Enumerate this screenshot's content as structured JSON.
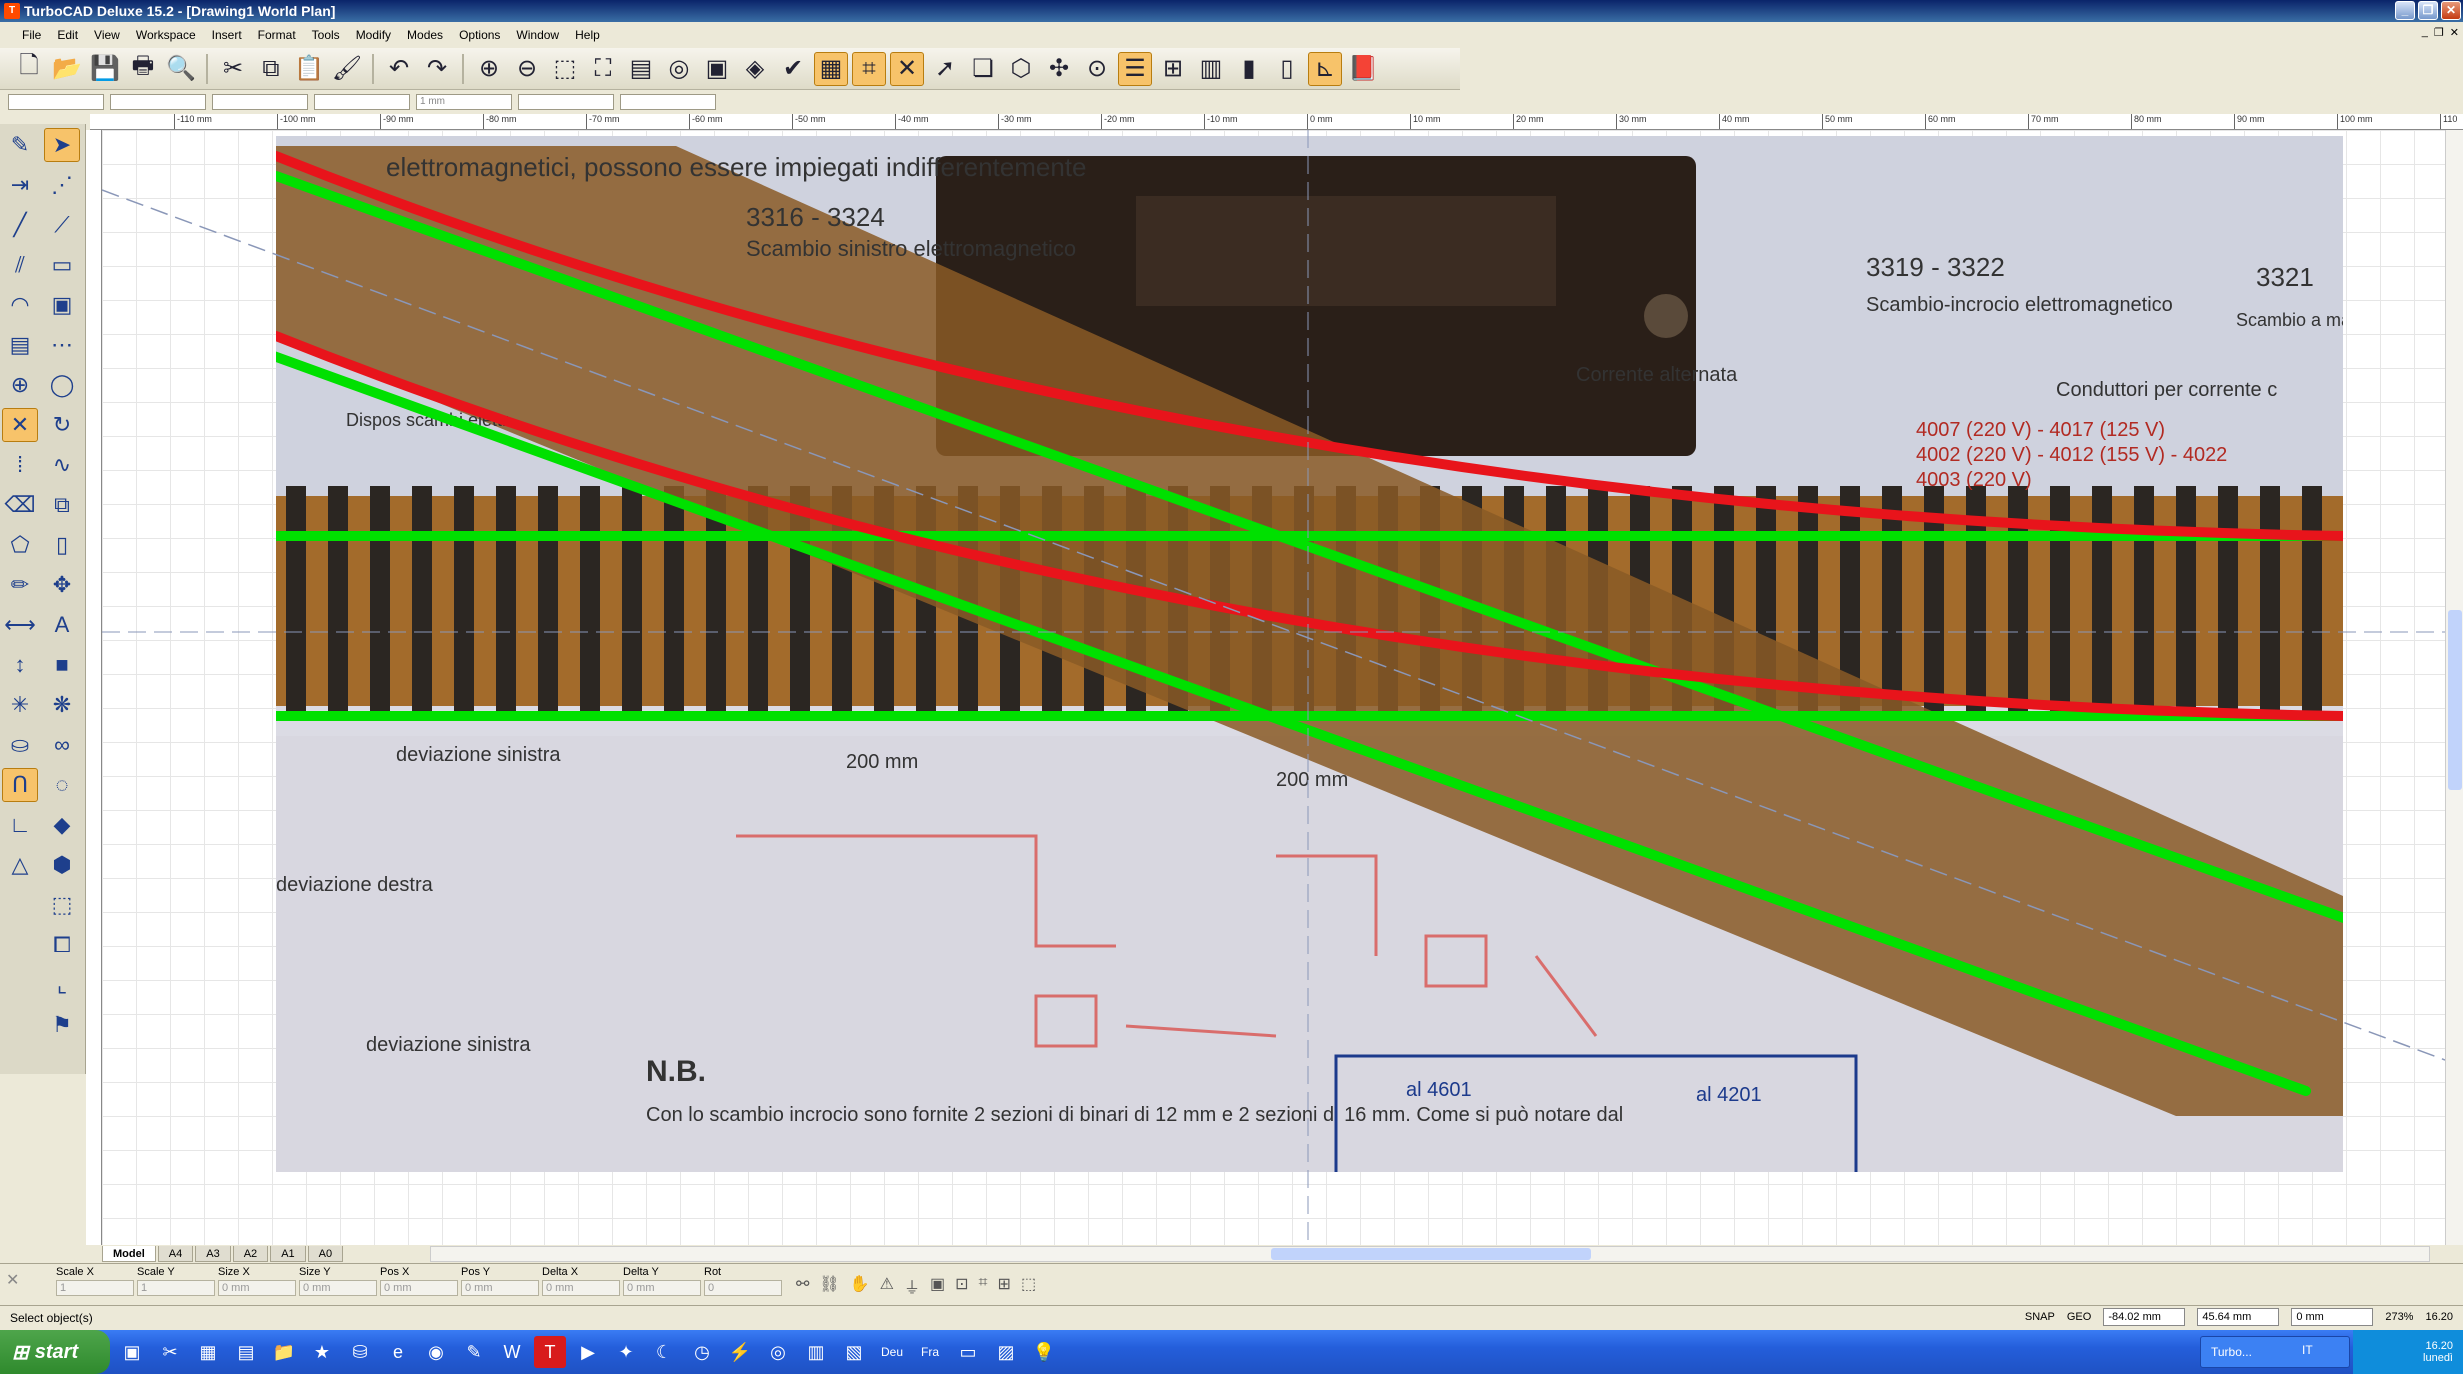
{
  "window": {
    "title": "TurboCAD Deluxe 15.2 - [Drawing1 World Plan]",
    "app_icon": "turbocad-icon"
  },
  "menu": [
    "File",
    "Edit",
    "View",
    "Workspace",
    "Insert",
    "Format",
    "Tools",
    "Modify",
    "Modes",
    "Options",
    "Window",
    "Help"
  ],
  "toolbar": {
    "icons": [
      "new-icon",
      "open-icon",
      "save-icon",
      "print-icon",
      "print-preview-icon",
      "cut-icon",
      "copy-icon",
      "paste-icon",
      "format-painter-icon",
      "undo-icon",
      "redo-icon",
      "zoom-in-icon",
      "zoom-out-icon",
      "zoom-window-icon",
      "zoom-extents-icon",
      "pages-icon",
      "zoom-all-icon",
      "render-icon",
      "snap-icon",
      "spell-check-icon",
      "grid-icon",
      "snap-grid-icon",
      "snap-intersect-icon",
      "select-icon",
      "layers-icon",
      "3d-box-icon",
      "3d-orbit-icon",
      "camera-icon",
      "design-director-icon",
      "properties-icon",
      "hatch-icon",
      "palette-icon",
      "page-icon",
      "ucs-icon",
      "book-icon"
    ]
  },
  "property_bar": {
    "line_width": "1 mm"
  },
  "ruler": {
    "ticks": [
      "-110 mm",
      "-100 mm",
      "-90 mm",
      "-80 mm",
      "-70 mm",
      "-60 mm",
      "-50 mm",
      "-40 mm",
      "-30 mm",
      "-20 mm",
      "-10 mm",
      "0 mm",
      "10 mm",
      "20 mm",
      "30 mm",
      "40 mm",
      "50 mm",
      "60 mm",
      "70 mm",
      "80 mm",
      "90 mm",
      "100 mm",
      "110"
    ]
  },
  "drawing": {
    "photo_labels": {
      "part_a": "3316 - 3324",
      "part_a_desc": "Scambio sinistro elettromagnetico",
      "part_b": "3319 - 3322",
      "part_b_desc": "Scambio-incrocio elettromagnetico",
      "part_c": "3321",
      "part_c_desc": "Scambio a mano",
      "top_text": "elettromagnetici, possono essere impiegati indifferentemente",
      "corrente": "Corrente alternata",
      "conduttori": "Conduttori per corrente c",
      "codes": [
        "4007 (220 V) - 4017 (125 V)",
        "4002 (220 V) - 4012 (155 V) - 4022",
        "4003 (220 V)"
      ],
      "dev_sx1": "deviazione sinistra",
      "dev_dx": "deviazione destra",
      "dev_sx2": "deviazione sinistra",
      "dim1": "200 mm",
      "dim2": "200 mm",
      "nb_title": "N.B.",
      "nb_text": "Con lo scambio incrocio sono fornite 2 sezioni di binari di 12 mm e 2 sezioni di 16 mm. Come si può notare dal",
      "box_a": "al 4601",
      "box_b": "al 4201",
      "dispos": "Dispos scambi elettr"
    },
    "colors": {
      "track_green": "#00e000",
      "track_red": "#e8141b"
    }
  },
  "tabs": [
    "Model",
    "A4",
    "A3",
    "A2",
    "A1",
    "A0"
  ],
  "inspector": {
    "fields": [
      {
        "label": "Scale X",
        "value": "1"
      },
      {
        "label": "Scale Y",
        "value": "1"
      },
      {
        "label": "Size X",
        "value": "0 mm"
      },
      {
        "label": "Size Y",
        "value": "0 mm"
      },
      {
        "label": "Pos X",
        "value": "0 mm"
      },
      {
        "label": "Pos Y",
        "value": "0 mm"
      },
      {
        "label": "Delta X",
        "value": "0 mm"
      },
      {
        "label": "Delta Y",
        "value": "0 mm"
      },
      {
        "label": "Rot",
        "value": "0"
      }
    ]
  },
  "status": {
    "message": "Select object(s)",
    "snap": "SNAP",
    "geo": "GEO",
    "x": "-84.02 mm",
    "y": "45.64 mm",
    "z": "0 mm",
    "zoom": "273%",
    "time": "16.20"
  },
  "taskbar": {
    "start": "start",
    "task": "Turbo...",
    "lang": "IT",
    "clock": "16.20",
    "day": "lunedì"
  }
}
